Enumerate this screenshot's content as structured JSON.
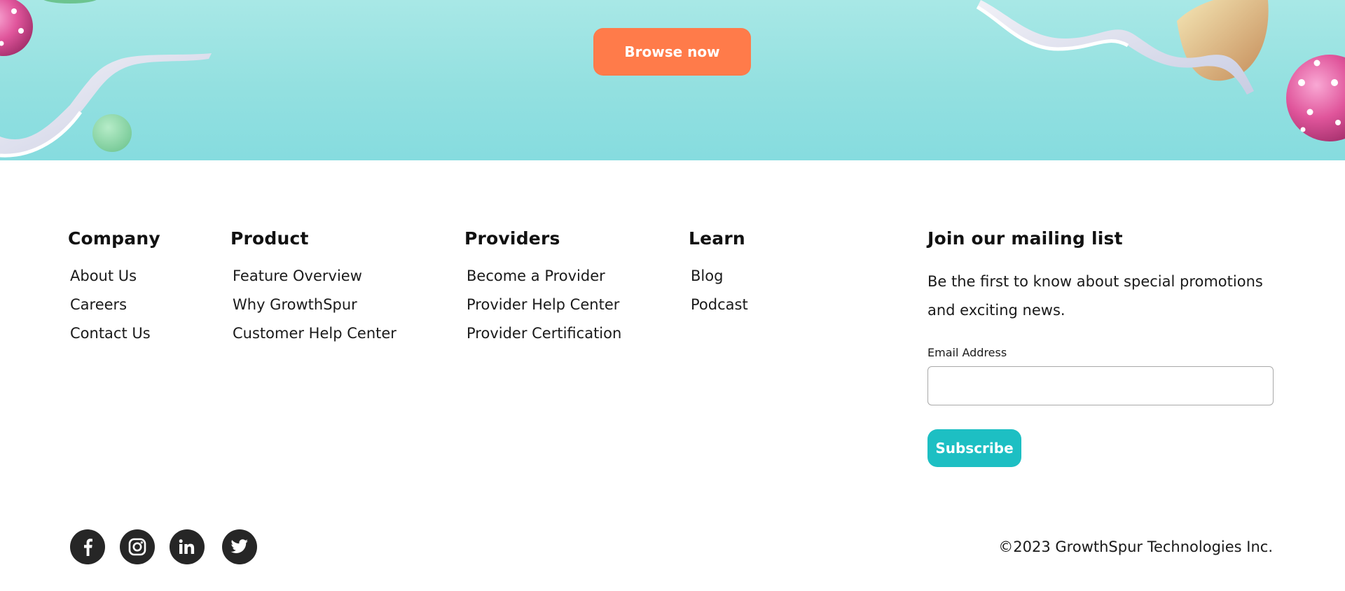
{
  "hero": {
    "browse_label": "Browse now"
  },
  "footer": {
    "columns": [
      {
        "title": "Company",
        "links": [
          "About Us",
          "Careers",
          "Contact Us"
        ]
      },
      {
        "title": "Product",
        "links": [
          "Feature Overview",
          "Why GrowthSpur",
          "Customer Help Center"
        ]
      },
      {
        "title": "Providers",
        "links": [
          "Become a Provider",
          "Provider Help Center",
          "Provider Certification"
        ]
      },
      {
        "title": "Learn",
        "links": [
          "Blog",
          "Podcast"
        ]
      }
    ],
    "mailing": {
      "title": "Join our mailing list",
      "description": "Be the first to know about special promotions and exciting news.",
      "email_label": "Email Address",
      "email_value": "",
      "subscribe_label": "Subscribe"
    },
    "socials": [
      "facebook-icon",
      "instagram-icon",
      "linkedin-icon",
      "twitter-icon"
    ],
    "copyright": "©2023 GrowthSpur Technologies Inc."
  },
  "colors": {
    "hero_top": "#a8e8e6",
    "hero_bottom": "#86dcdf",
    "browse_button": "#ff7b4a",
    "subscribe_button": "#1dbfc3",
    "social_icon_bg": "#262626"
  }
}
